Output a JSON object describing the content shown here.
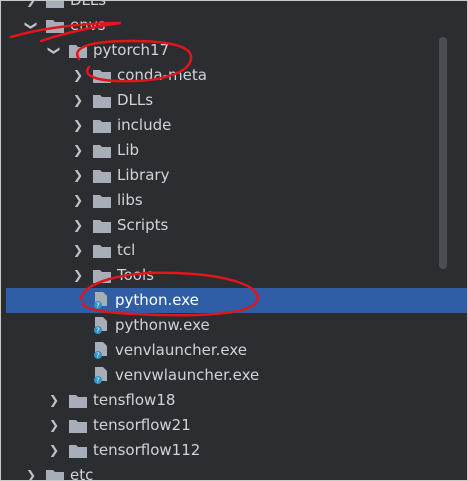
{
  "tree": {
    "items": [
      {
        "label": "DLLs",
        "icon": "folder-icon",
        "state": "collapsed"
      },
      {
        "label": "envs",
        "icon": "folder-icon",
        "state": "expanded"
      },
      {
        "label": "pytorch17",
        "icon": "folder-icon",
        "state": "expanded"
      },
      {
        "label": "conda-meta",
        "icon": "folder-icon",
        "state": "collapsed"
      },
      {
        "label": "DLLs",
        "icon": "folder-icon",
        "state": "collapsed"
      },
      {
        "label": "include",
        "icon": "folder-icon",
        "state": "collapsed"
      },
      {
        "label": "Lib",
        "icon": "folder-icon",
        "state": "collapsed"
      },
      {
        "label": "Library",
        "icon": "folder-icon",
        "state": "collapsed"
      },
      {
        "label": "libs",
        "icon": "folder-icon",
        "state": "collapsed"
      },
      {
        "label": "Scripts",
        "icon": "folder-icon",
        "state": "collapsed"
      },
      {
        "label": "tcl",
        "icon": "folder-icon",
        "state": "collapsed"
      },
      {
        "label": "Tools",
        "icon": "folder-icon",
        "state": "collapsed"
      },
      {
        "label": "python.exe",
        "icon": "unknown-file-icon",
        "state": "selected"
      },
      {
        "label": "pythonw.exe",
        "icon": "unknown-file-icon"
      },
      {
        "label": "venvlauncher.exe",
        "icon": "unknown-file-icon"
      },
      {
        "label": "venvwlauncher.exe",
        "icon": "unknown-file-icon"
      },
      {
        "label": "tensflow18",
        "icon": "folder-icon",
        "state": "collapsed"
      },
      {
        "label": "tensorflow21",
        "icon": "folder-icon",
        "state": "collapsed"
      },
      {
        "label": "tensorflow112",
        "icon": "folder-icon",
        "state": "collapsed"
      },
      {
        "label": "etc",
        "icon": "folder-icon",
        "state": "collapsed"
      }
    ]
  },
  "colors": {
    "background": "#2b2d30",
    "text": "#cfd3da",
    "selection": "#2f5ea6",
    "folder": "#a7aeb8",
    "annotation": "#e0161b"
  }
}
